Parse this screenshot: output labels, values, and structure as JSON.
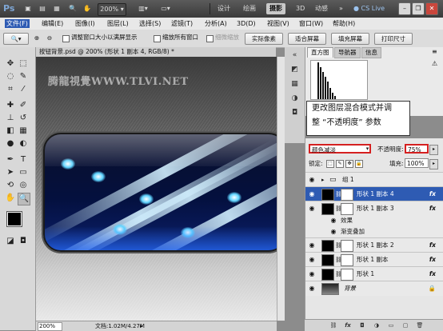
{
  "titlebar": {
    "app_logo": "Ps",
    "zoom_value": "200%",
    "workspaces": [
      "设计",
      "绘画",
      "摄影",
      "3D",
      "动感"
    ],
    "active_workspace": "摄影",
    "cslive": "CS Live"
  },
  "menu": [
    "文件(F)",
    "编辑(E)",
    "图像(I)",
    "图层(L)",
    "选择(S)",
    "滤镜(T)",
    "分析(A)",
    "3D(D)",
    "视图(V)",
    "窗口(W)",
    "帮助(H)"
  ],
  "options": {
    "cb_resize_windows": "调整窗口大小以满屏显示",
    "cb_zoom_all": "缩放所有窗口",
    "cb_scrubby": "细微缩放",
    "btn_actual_pixels": "实际像素",
    "btn_fit_screen": "适合屏幕",
    "btn_fill_screen": "填充屏幕",
    "btn_print_size": "打印尺寸"
  },
  "document": {
    "tab_title": "按钮背景.psd @ 200% (形状 1 副本 4, RGB/8) *",
    "watermark": "腾龍視覺WWW.TLVI.NET",
    "status_zoom": "200%",
    "status_doc": "文档:1.02M/4.27M"
  },
  "panels": {
    "histogram_tabs": [
      "直方图",
      "导航器",
      "信息"
    ],
    "callout_lines": [
      "更改图层混合模式并调",
      "整 “不透明度” 参数"
    ]
  },
  "layers": {
    "blend_mode": "颜色减淡",
    "opacity_label": "不透明度:",
    "opacity_value": "75%",
    "lock_label": "锁定:",
    "fill_label": "填充:",
    "fill_value": "100%",
    "group_name": "组 1",
    "rows": [
      {
        "name": "形状 1 副本 4",
        "fx": "fx"
      },
      {
        "name": "形状 1 副本 3",
        "fx": "fx"
      },
      {
        "name": "效果",
        "fx": ""
      },
      {
        "name": "渐变叠加",
        "fx": ""
      },
      {
        "name": "形状 1 副本 2",
        "fx": "fx"
      },
      {
        "name": "形状 1 副本",
        "fx": "fx"
      },
      {
        "name": "形状 1",
        "fx": "fx"
      },
      {
        "name": "背景",
        "fx": ""
      }
    ]
  }
}
